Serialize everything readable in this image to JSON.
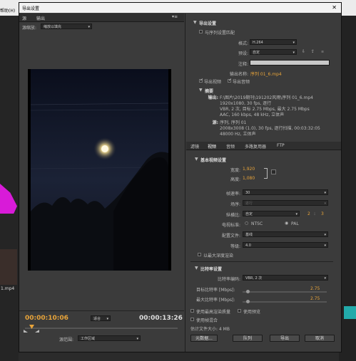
{
  "background": {
    "menu_fragment": "帮助(H)",
    "thumb_label": "1.mp4"
  },
  "dialog": {
    "title": "导出设置",
    "close_label": "✕",
    "left": {
      "tabs": [
        "源",
        "输出"
      ],
      "scale_label": "源缩放:",
      "scale_value": "缩放以填充",
      "timecode_current": "00:00:10:06",
      "fit_value": "适合",
      "timecode_total": "00:00:13:26",
      "source_range_label": "源范围:",
      "source_range_value": "工作区域"
    },
    "right": {
      "export_settings_title": "导出设置",
      "match_sequence_label": "与序列设置匹配",
      "format_label": "格式:",
      "format_value": "H.264",
      "preset_label": "预设:",
      "preset_value": "自定",
      "comment_label": "注释:",
      "output_name_label": "输出名称:",
      "output_name_value": "序列 01_6.mp4",
      "export_video_label": "导出视频",
      "export_audio_label": "导出音频",
      "summary_title": "摘要",
      "output_label": "输出:",
      "output_lines": [
        "F:\\图片\\2019期刊\\191202风雨\\序列 01_6.mp4",
        "1920x1080, 30 fps, 逐行",
        "VBR, 2 次, 目标 2.75 Mbps, 最大 2.75 Mbps",
        "AAC, 160 kbps, 48 kHz, 立体声"
      ],
      "source_label": "源:",
      "source_lines": [
        "序列, 序列 01",
        "2008x3008 (1.0), 30 fps, 逐行扫描, 00:03:32:05",
        "48000 Hz, 立体声"
      ],
      "tabs": [
        "滤镜",
        "视频",
        "音频",
        "多路复用器",
        "FTP"
      ],
      "basic_video_title": "基本视频设置",
      "width_label": "宽度:",
      "width_value": "1,920",
      "height_label": "高度:",
      "height_value": "1,080",
      "framerate_label": "帧速率:",
      "framerate_value": "30",
      "field_label": "场序:",
      "field_value": "逐行",
      "aspect_label": "纵横比:",
      "aspect_value": "自定",
      "aspect_num": "2",
      "aspect_colon": ":",
      "aspect_den": "3",
      "tv_label": "电视标准:",
      "ntsc_label": "NTSC",
      "pal_label": "PAL",
      "profile_label": "配置文件:",
      "profile_value": "基线",
      "level_label": "等级:",
      "level_value": "4.0",
      "max_depth_label": "以最大深度渲染",
      "bitrate_title": "比特率设置",
      "bitrate_encoding_label": "比特率编码:",
      "bitrate_encoding_value": "VBR, 2 次",
      "target_bitrate_label": "目标比特率 [Mbps]:",
      "target_bitrate_value": "2.75",
      "max_bitrate_label": "最大比特率 [Mbps]:",
      "max_bitrate_value": "2.75",
      "max_render_quality_label": "使用最高渲染质量",
      "use_preview_label": "使用预览",
      "use_frame_blending_label": "使用帧混合",
      "file_size_label": "估计文件大小: 4 MB",
      "metadata_button": "元数据...",
      "queue_button": "队列",
      "export_button": "导出",
      "cancel_button": "取消"
    }
  },
  "colors": {
    "accent": "#e8a43a",
    "panel": "#3b3b3b"
  }
}
